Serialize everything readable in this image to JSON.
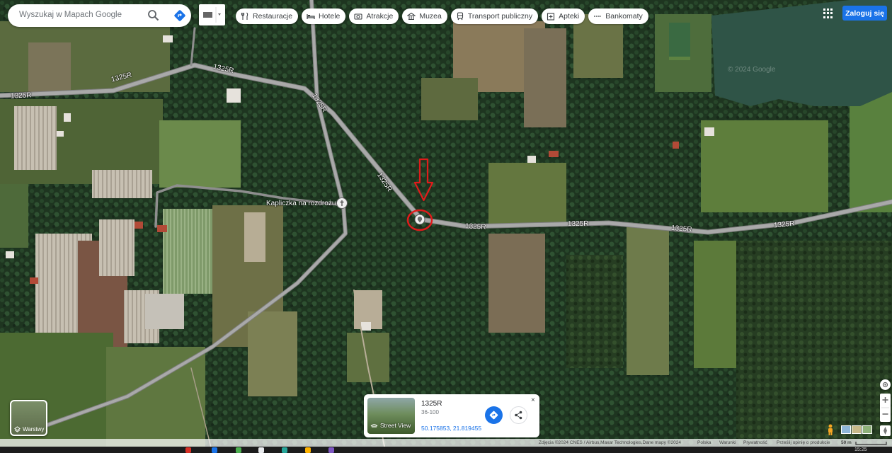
{
  "search": {
    "placeholder": "Wyszukaj w Mapach Google"
  },
  "categories": [
    {
      "label": "Restauracje",
      "icon": "cutlery-icon"
    },
    {
      "label": "Hotele",
      "icon": "bed-icon"
    },
    {
      "label": "Atrakcje",
      "icon": "camera-icon"
    },
    {
      "label": "Muzea",
      "icon": "museum-icon"
    },
    {
      "label": "Transport publiczny",
      "icon": "train-icon"
    },
    {
      "label": "Apteki",
      "icon": "pharmacy-icon"
    },
    {
      "label": "Bankomaty",
      "icon": "atm-icon"
    }
  ],
  "header": {
    "sign_in": "Zaloguj się"
  },
  "map": {
    "road_labels": [
      "1325R",
      "1325R",
      "1325R",
      "1325R",
      "1325R",
      "1325R",
      "1325R",
      "1325R",
      "1325R"
    ],
    "poi_label": "Kapliczka na rozdrożu",
    "watermark": "© 2024 Google"
  },
  "layers": {
    "label": "Warstwy"
  },
  "place_card": {
    "title": "1325R",
    "subtitle": "36-100",
    "coords": "50.175853, 21.819455",
    "street_view": "Street View",
    "close": "×"
  },
  "footer": {
    "attribution": "Zdjęcia ©2024 CNES / Airbus,Maxar Technologies,Dane mapy ©2024",
    "country": "Polska",
    "terms": "Warunki",
    "privacy": "Prywatność",
    "feedback": "Prześlij opinię o produkcie",
    "scale": "50 m"
  },
  "taskbar": {
    "time": "15:25"
  },
  "colors": {
    "accent": "#1a73e8",
    "marker": "#e01b1b",
    "road": "#9a9a9a"
  }
}
